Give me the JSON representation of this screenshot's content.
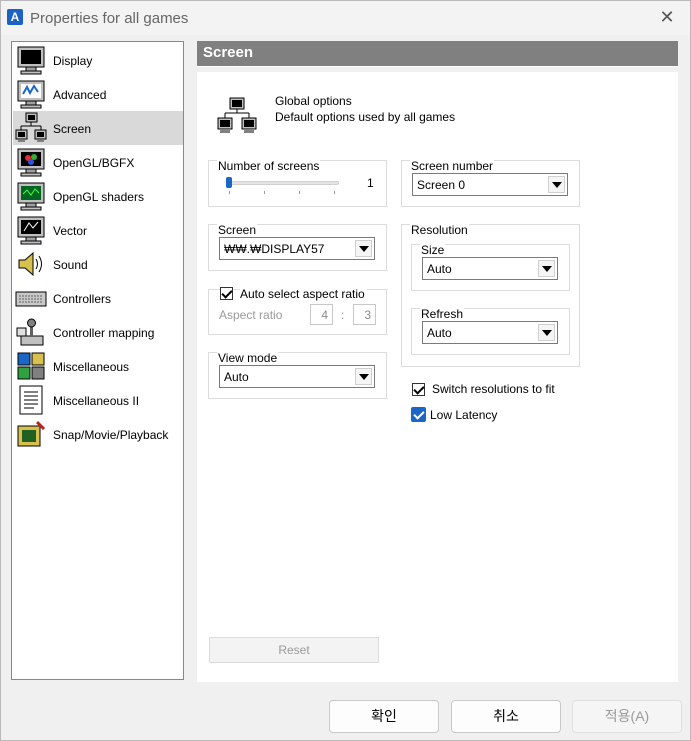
{
  "window": {
    "title": "Properties for all games",
    "app_icon": "mame-app-icon",
    "close_icon": "close-icon"
  },
  "categories": [
    {
      "label": "Display",
      "icon": "monitor-icon",
      "selected": false
    },
    {
      "label": "Advanced",
      "icon": "advanced-monitor-icon",
      "selected": false
    },
    {
      "label": "Screen",
      "icon": "screens-network-icon",
      "selected": true
    },
    {
      "label": "OpenGL/BGFX",
      "icon": "opengl-icon",
      "selected": false
    },
    {
      "label": "OpenGL shaders",
      "icon": "shader-monitor-icon",
      "selected": false
    },
    {
      "label": "Vector",
      "icon": "vector-monitor-icon",
      "selected": false
    },
    {
      "label": "Sound",
      "icon": "speaker-icon",
      "selected": false
    },
    {
      "label": "Controllers",
      "icon": "keyboard-icon",
      "selected": false
    },
    {
      "label": "Controller mapping",
      "icon": "joystick-icon",
      "selected": false
    },
    {
      "label": "Miscellaneous",
      "icon": "puzzle-icon",
      "selected": false
    },
    {
      "label": "Miscellaneous II",
      "icon": "document-icon",
      "selected": false
    },
    {
      "label": "Snap/Movie/Playback",
      "icon": "camera-icon",
      "selected": false
    }
  ],
  "panel": {
    "header": "Screen",
    "global_title": "Global options",
    "global_desc": "Default options used by all games",
    "num_screens": {
      "label": "Number of screens",
      "value": "1",
      "slider_fraction": 0
    },
    "screen_number": {
      "label": "Screen number",
      "value": "Screen 0"
    },
    "screen": {
      "label": "Screen",
      "value": "₩₩.₩DISPLAY57"
    },
    "auto_aspect": {
      "label": "Auto select aspect ratio",
      "checked": true
    },
    "aspect": {
      "label": "Aspect ratio",
      "num": "4",
      "sep": ":",
      "den": "3"
    },
    "view_mode": {
      "label": "View mode",
      "value": "Auto"
    },
    "resolution": {
      "label": "Resolution",
      "size_label": "Size",
      "size_value": "Auto",
      "refresh_label": "Refresh",
      "refresh_value": "Auto"
    },
    "switch_res": {
      "label": "Switch resolutions to fit",
      "checked": true
    },
    "low_latency": {
      "label": "Low Latency",
      "checked": true
    },
    "reset_label": "Reset"
  },
  "buttons": {
    "ok": "확인",
    "cancel": "취소",
    "apply": "적용(A)"
  },
  "colors": {
    "accent": "#1a67c8",
    "header_bg": "#808080",
    "selected_bg": "#d9d9d9"
  }
}
